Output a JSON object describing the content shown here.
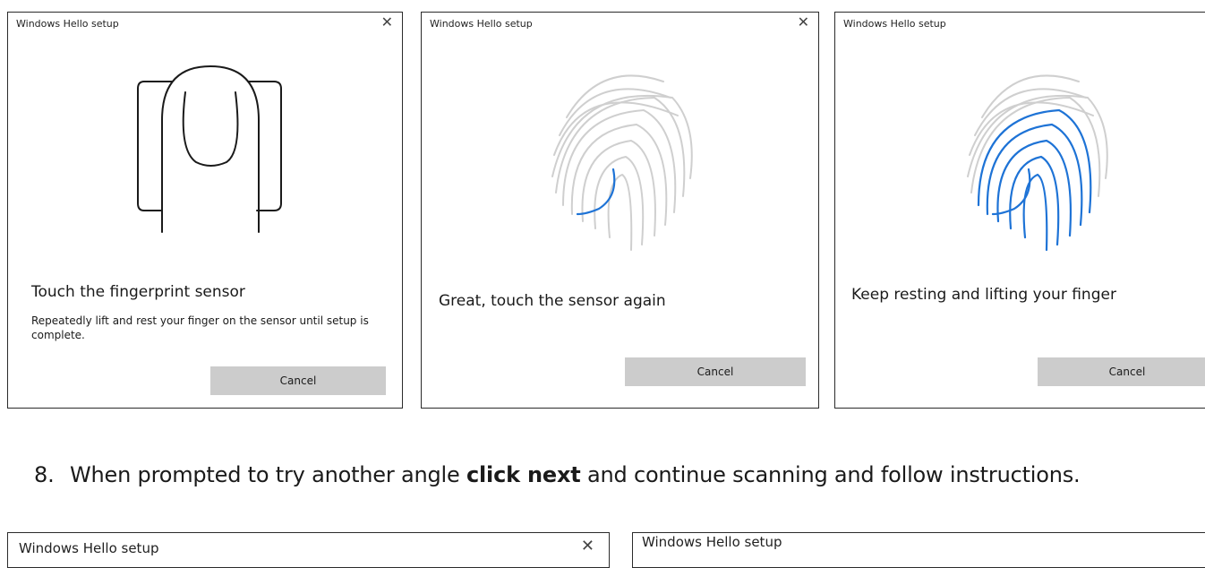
{
  "dialogs": [
    {
      "title": "Windows Hello setup",
      "close_glyph": "✕",
      "heading": "Touch the fingerprint sensor",
      "body": "Repeatedly lift and rest your finger on the sensor until setup is complete.",
      "cancel_label": "Cancel",
      "illustration": "finger-on-sensor-icon"
    },
    {
      "title": "Windows Hello setup",
      "close_glyph": "✕",
      "heading": "Great, touch the sensor again",
      "cancel_label": "Cancel",
      "illustration": "fingerprint-icon",
      "scan_progress": "small"
    },
    {
      "title": "Windows Hello setup",
      "heading": "Keep resting and lifting your finger",
      "cancel_label": "Cancel",
      "illustration": "fingerprint-icon",
      "scan_progress": "large"
    }
  ],
  "instruction": {
    "number": "8.",
    "text_before": "When prompted to try another angle ",
    "bold": "click next",
    "text_after": " and continue scanning and follow instructions."
  },
  "partial_dialogs": [
    {
      "title": "Windows Hello setup",
      "close_glyph": "✕"
    },
    {
      "title": "Windows Hello setup"
    }
  ],
  "colors": {
    "accent_blue": "#1e73d6",
    "ridge_gray": "#cfcfcf",
    "button_gray": "#cccccc",
    "border": "#2b2b2b"
  }
}
